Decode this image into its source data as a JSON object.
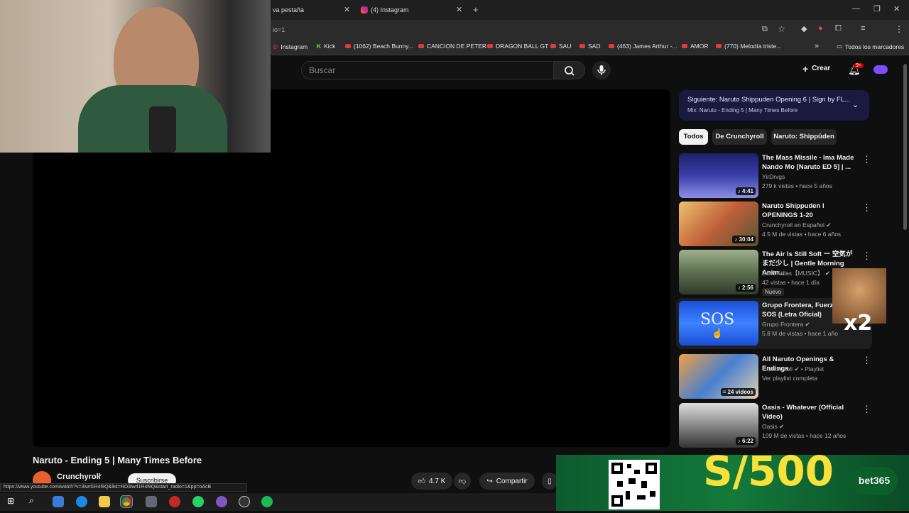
{
  "browser": {
    "tabs": [
      {
        "label": "va pestaña"
      },
      {
        "label": "(4) Instagram"
      }
    ],
    "url_fragment": "io=1",
    "bookmarks": [
      "Instagram",
      "Kick",
      "(1062) Beach Bunny...",
      "CANCION DE PETER",
      "DRAGON BALL GT",
      "SAU",
      "SAD",
      "(463) James Arthur -...",
      "AMOR",
      "(770) Melodía triste..."
    ],
    "all_bookmarks": "Todos los marcadores",
    "status_url": "https://www.youtube.com/watch?v=3iwrl1R4l9Q&list=RD3iwrl1R4l9Q&start_radio=1&pp=oAcB"
  },
  "header": {
    "search_placeholder": "Buscar",
    "create_label": "Crear",
    "notif_badge": "9+"
  },
  "video": {
    "title": "Naruto - Ending 5 | Many Times Before",
    "channel": "Crunchyroll",
    "subscribe_label": "Suscribirse",
    "likes": "4.7 K",
    "share_label": "Compartir"
  },
  "next": {
    "title": "Siguiente: Naruto Shippuden Opening 6 | Sign by FL...",
    "subtitle": "Mix: Naruto - Ending 5 | Many Times Before"
  },
  "chips": [
    "Todos",
    "De Crunchyroll",
    "Naruto: Shippūden"
  ],
  "recommendations": [
    {
      "title": "The Mass Missile - Ima Made Nando Mo [Naruto ED 5] | ...",
      "channel": "YirDrvgs",
      "meta": "279 k vistas • hace 5 años",
      "duration": "4:41"
    },
    {
      "title": "Naruto Shippuden l OPENINGS 1-20",
      "channel": "Crunchyroll en Español",
      "meta": "4.5 M de vistas • hace 6 años",
      "duration": "30:04"
    },
    {
      "title": "The Air Is Still Soft ー 空気がまだ少し | Gentle Morning Anim...",
      "channel": "Echo Atllas【MUSIC】",
      "meta": "42 vistas • hace 1 día",
      "duration": "2:56",
      "badge": "Nuevo"
    },
    {
      "title": "Grupo Frontera, Fuerza R... SOS (Letra Oficial)",
      "channel": "Grupo Frontera",
      "meta": "5.8 M de vistas • hace 1 año",
      "duration": ""
    },
    {
      "title": "All Naruto Openings & Endings",
      "channel": "Crunchyroll",
      "meta": "Ver playlist completa",
      "duration": "24 videos",
      "extra": "• Playlist"
    },
    {
      "title": "Oasis - Whatever (Official Video)",
      "channel": "Oasis",
      "meta": "109 M de vistas • hace 12 años",
      "duration": "6:22"
    }
  ],
  "overlays": {
    "ad_amount": "S/500",
    "ad_brand": "bet365",
    "meme_text": "x2"
  },
  "colors": {
    "accent": "#ff0000",
    "next_bg": "#1a1a40",
    "ad_yellow": "#f8e23a"
  }
}
